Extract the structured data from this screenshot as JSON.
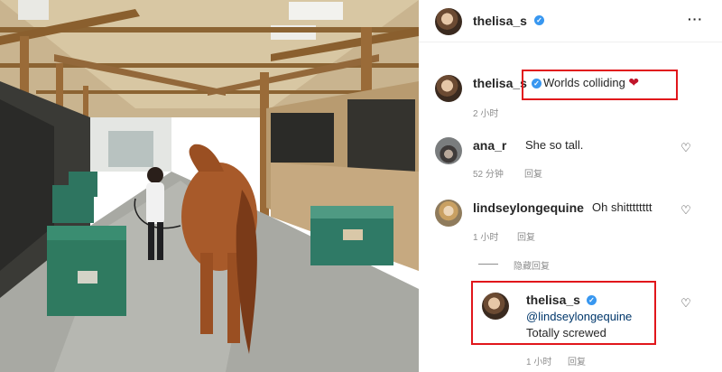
{
  "post": {
    "username": "thelisa_s",
    "more_icon": "more-horiz-icon"
  },
  "caption": {
    "username": "thelisa_s",
    "text": "Worlds colliding",
    "emoji": "❤",
    "time": "2 小时"
  },
  "comments": [
    {
      "username": "ana_r",
      "text": "She so tall.",
      "time": "52 分钟",
      "reply_label": "回复"
    },
    {
      "username": "lindseylongequine",
      "text": "Oh shitttttttt",
      "time": "1 小时",
      "reply_label": "回复"
    }
  ],
  "hide_replies_label": "隐藏回复",
  "reply": {
    "username": "thelisa_s",
    "mention": "@lindseylongequine",
    "text": "Totally screwed",
    "time": "1 小时",
    "reply_label": "回复"
  },
  "colors": {
    "highlight": "#e1161b",
    "verified": "#3897f0",
    "meta": "#8e8e8e"
  }
}
